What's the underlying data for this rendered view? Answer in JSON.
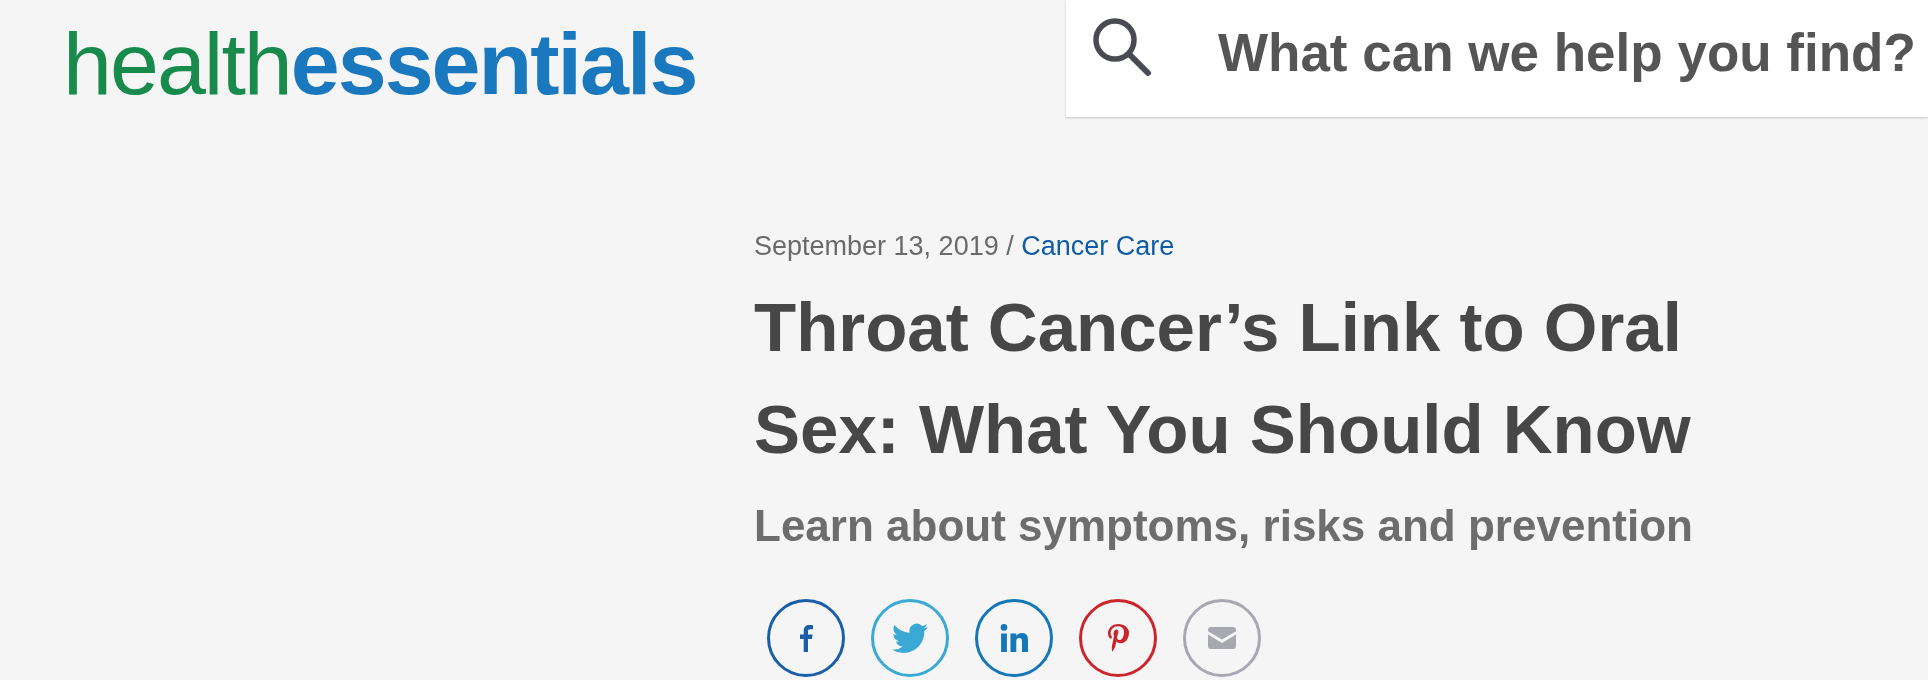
{
  "header": {
    "logo": "health**essentials**",
    "search": {
      "placeholder": "What can we help you find?"
    }
  },
  "article": {
    "date": "September 13, 2019",
    "separator": "/",
    "category": "Cancer Care",
    "title": "Throat Cancer’s Link to Oral Sex: What You Should Know",
    "subtitle": "Learn about symptoms, risks and prevention",
    "share_buttons": [
      {
        "kind": "facebook",
        "color": "#1a5ea8"
      },
      {
        "kind": "twitter",
        "color": "#3aa9d4"
      },
      {
        "kind": "linkedin",
        "color": "#1477b8"
      },
      {
        "kind": "pinterest",
        "color": "#cb262c"
      },
      {
        "kind": "email",
        "color": "#a8a9b0"
      }
    ]
  }
}
